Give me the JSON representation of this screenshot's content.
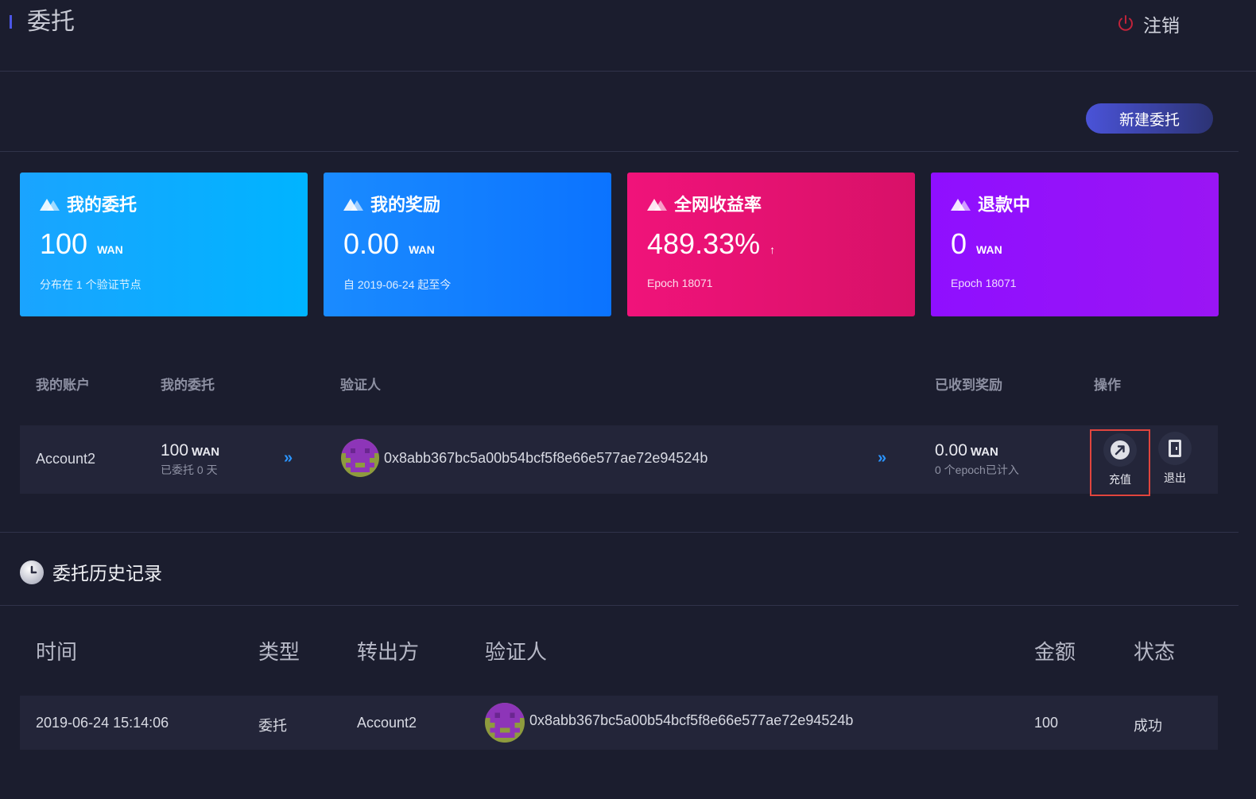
{
  "header": {
    "title": "委托",
    "logout_label": "注销"
  },
  "toolbar": {
    "new_delegation_label": "新建委托"
  },
  "cards": [
    {
      "title": "我的委托",
      "value": "100",
      "unit": "WAN",
      "sub": "分布在 1 个验证节点",
      "color": "#0aaeff"
    },
    {
      "title": "我的奖励",
      "value": "0.00",
      "unit": "WAN",
      "sub": "自 2019-06-24 起至今",
      "color": "#0b7dff"
    },
    {
      "title": "全网收益率",
      "value": "489.33%",
      "unit": "↑",
      "sub": "Epoch 18071",
      "color": "#e2126f"
    },
    {
      "title": "退款中",
      "value": "0",
      "unit": "WAN",
      "sub": "Epoch 18071",
      "color": "#9511fb"
    }
  ],
  "delegations": {
    "headers": {
      "account": "我的账户",
      "amount": "我的委托",
      "validator": "验证人",
      "rewards": "已收到奖励",
      "actions": "操作"
    },
    "rows": [
      {
        "account": "Account2",
        "amount": "100",
        "amount_unit": "WAN",
        "amount_sub": "已委托 0 天",
        "validator": "0x8abb367bc5a00b54bcf5f8e66e577ae72e94524b",
        "rewards": "0.00",
        "rewards_unit": "WAN",
        "rewards_sub": "0 个epoch已计入",
        "topup_label": "充值",
        "exit_label": "退出"
      }
    ]
  },
  "history": {
    "title": "委托历史记录",
    "headers": {
      "time": "时间",
      "type": "类型",
      "from": "转出方",
      "validator": "验证人",
      "amount": "金额",
      "status": "状态"
    },
    "rows": [
      {
        "time": "2019-06-24 15:14:06",
        "type": "委托",
        "from": "Account2",
        "validator": "0x8abb367bc5a00b54bcf5f8e66e577ae72e94524b",
        "amount": "100",
        "status": "成功"
      }
    ]
  },
  "colors": {
    "background": "#1b1d2e",
    "row_bg": "#232539",
    "accent": "#4a53d8",
    "chevron": "#2b95ff",
    "highlight": "#e0453e",
    "logout_icon": "#c0233a"
  }
}
